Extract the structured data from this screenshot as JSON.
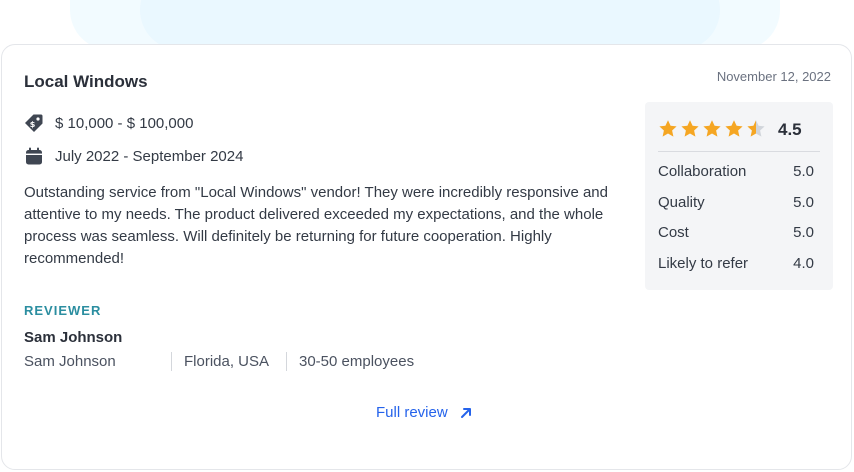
{
  "review": {
    "title": "Local Windows",
    "date": "November 12, 2022",
    "budget": "$ 10,000 - $ 100,000",
    "period": "July 2022 - September 2024",
    "text": "Outstanding service from \"Local Windows\" vendor! They were incredibly responsive and attentive to my needs. The product delivered exceeded my expectations, and the whole process was seamless. Will definitely be returning for future cooperation. Highly recommended!"
  },
  "reviewer": {
    "label": "REVIEWER",
    "name": "Sam Johnson",
    "position": "Sam Johnson",
    "location": "Florida, USA",
    "company_size": "30-50 employees"
  },
  "link": {
    "full_review": "Full review"
  },
  "rating": {
    "overall": "4.5",
    "stars_value": 4.5,
    "star_color": "#f5a623",
    "star_empty_color": "#d1d5db",
    "rows": [
      {
        "label": "Collaboration",
        "value": "5.0"
      },
      {
        "label": "Quality",
        "value": "5.0"
      },
      {
        "label": "Cost",
        "value": "5.0"
      },
      {
        "label": "Likely to refer",
        "value": "4.0"
      }
    ]
  },
  "icons": {
    "budget": "price-tag-icon",
    "period": "calendar-icon",
    "link": "arrow-up-right-icon"
  },
  "colors": {
    "accent": "#2563eb",
    "reviewer_label": "#2b8ea0"
  }
}
